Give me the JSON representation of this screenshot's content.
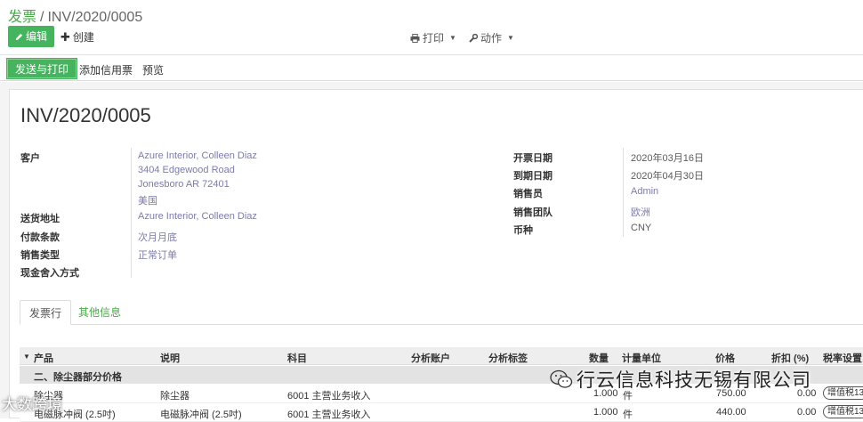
{
  "breadcrumb": {
    "parent": "发票",
    "separator": "/",
    "current": "INV/2020/0005"
  },
  "toolbar": {
    "edit_label": "编辑",
    "create_label": "创建",
    "print_label": "打印",
    "action_label": "动作"
  },
  "statusbar": {
    "send_print": "发送与打印",
    "add_credit": "添加信用票",
    "preview": "预览"
  },
  "invoice": {
    "title": "INV/2020/0005",
    "customer_label": "客户",
    "customer_lines": [
      "Azure Interior, Colleen Diaz",
      "3404 Edgewood Road",
      "Jonesboro AR 72401",
      "美国"
    ],
    "shipping_label": "送货地址",
    "shipping_value": "Azure Interior, Colleen Diaz",
    "payment_terms_label": "付款条款",
    "payment_terms_value": "次月月底",
    "sale_type_label": "销售类型",
    "sale_type_value": "正常订单",
    "cash_rounding_label": "现金舍入方式",
    "invoice_date_label": "开票日期",
    "invoice_date_value": "2020年03月16日",
    "due_date_label": "到期日期",
    "due_date_value": "2020年04月30日",
    "salesperson_label": "销售员",
    "salesperson_value": "Admin",
    "sales_team_label": "销售团队",
    "sales_team_value": "欧洲",
    "currency_label": "币种",
    "currency_value": "CNY"
  },
  "tabs": {
    "lines": "发票行",
    "other": "其他信息"
  },
  "table": {
    "headers": {
      "product": "产品",
      "desc": "说明",
      "account": "科目",
      "analytic_account": "分析账户",
      "analytic_tags": "分析标签",
      "qty": "数量",
      "uom": "计量单位",
      "price": "价格",
      "discount": "折扣 (%)",
      "taxes": "税率设置"
    },
    "section": "二、除尘器部分价格",
    "rows": [
      {
        "product": "除尘器",
        "desc": "除尘器",
        "account": "6001 主营业务收入",
        "qty": "1.000",
        "uom": "件",
        "price": "750.00",
        "discount": "0.00",
        "tax": "增值税13"
      },
      {
        "product": "电磁脉冲阀 (2.5吋)",
        "desc": "电磁脉冲阀 (2.5吋)",
        "account": "6001 主营业务收入",
        "qty": "1.000",
        "uom": "件",
        "price": "440.00",
        "discount": "0.00",
        "tax": "增值税13"
      }
    ]
  },
  "watermark": {
    "company": "行云信息科技无锡有限公司",
    "brand": "大数跨境"
  }
}
